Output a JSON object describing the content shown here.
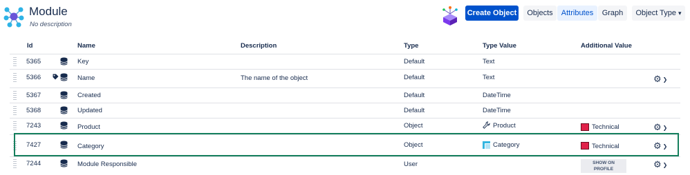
{
  "header": {
    "title": "Module",
    "subtitle": "No description",
    "buttons": {
      "create": "Create Object",
      "objects": "Objects",
      "attributes": "Attributes",
      "graph": "Graph",
      "object_type": "Object Type"
    }
  },
  "table": {
    "columns": [
      "Id",
      "Name",
      "Description",
      "Type",
      "Type Value",
      "Additional Value"
    ],
    "rows": [
      {
        "id": "5365",
        "name": "Key",
        "description": "",
        "type": "Default",
        "type_value": "Text",
        "additional": ""
      },
      {
        "id": "5366",
        "name": "Name",
        "description": "The name of the object",
        "type": "Default",
        "type_value": "Text",
        "additional": ""
      },
      {
        "id": "5367",
        "name": "Created",
        "description": "",
        "type": "Default",
        "type_value": "DateTime",
        "additional": ""
      },
      {
        "id": "5368",
        "name": "Updated",
        "description": "",
        "type": "Default",
        "type_value": "DateTime",
        "additional": ""
      },
      {
        "id": "7243",
        "name": "Product",
        "description": "",
        "type": "Object",
        "type_value": "Product",
        "additional": "Technical"
      },
      {
        "id": "7427",
        "name": "Category",
        "description": "",
        "type": "Object",
        "type_value": "Category",
        "additional": "Technical"
      },
      {
        "id": "7244",
        "name": "Module Responsible",
        "description": "",
        "type": "User",
        "type_value": "",
        "additional": ""
      }
    ],
    "show_on_profile": [
      "SHOW ON",
      "PROFILE"
    ]
  },
  "colors": {
    "primary": "#0052cc",
    "highlight_border": "#157f5d",
    "swatch": "#e0224a"
  },
  "icons": {
    "logo": "network-logo-icon",
    "object_type": "cube-icon",
    "row": "database-icon",
    "label": "tag-icon",
    "product_type": "wrench-icon",
    "category_type": "category-icon",
    "actions": "gear-icon"
  }
}
